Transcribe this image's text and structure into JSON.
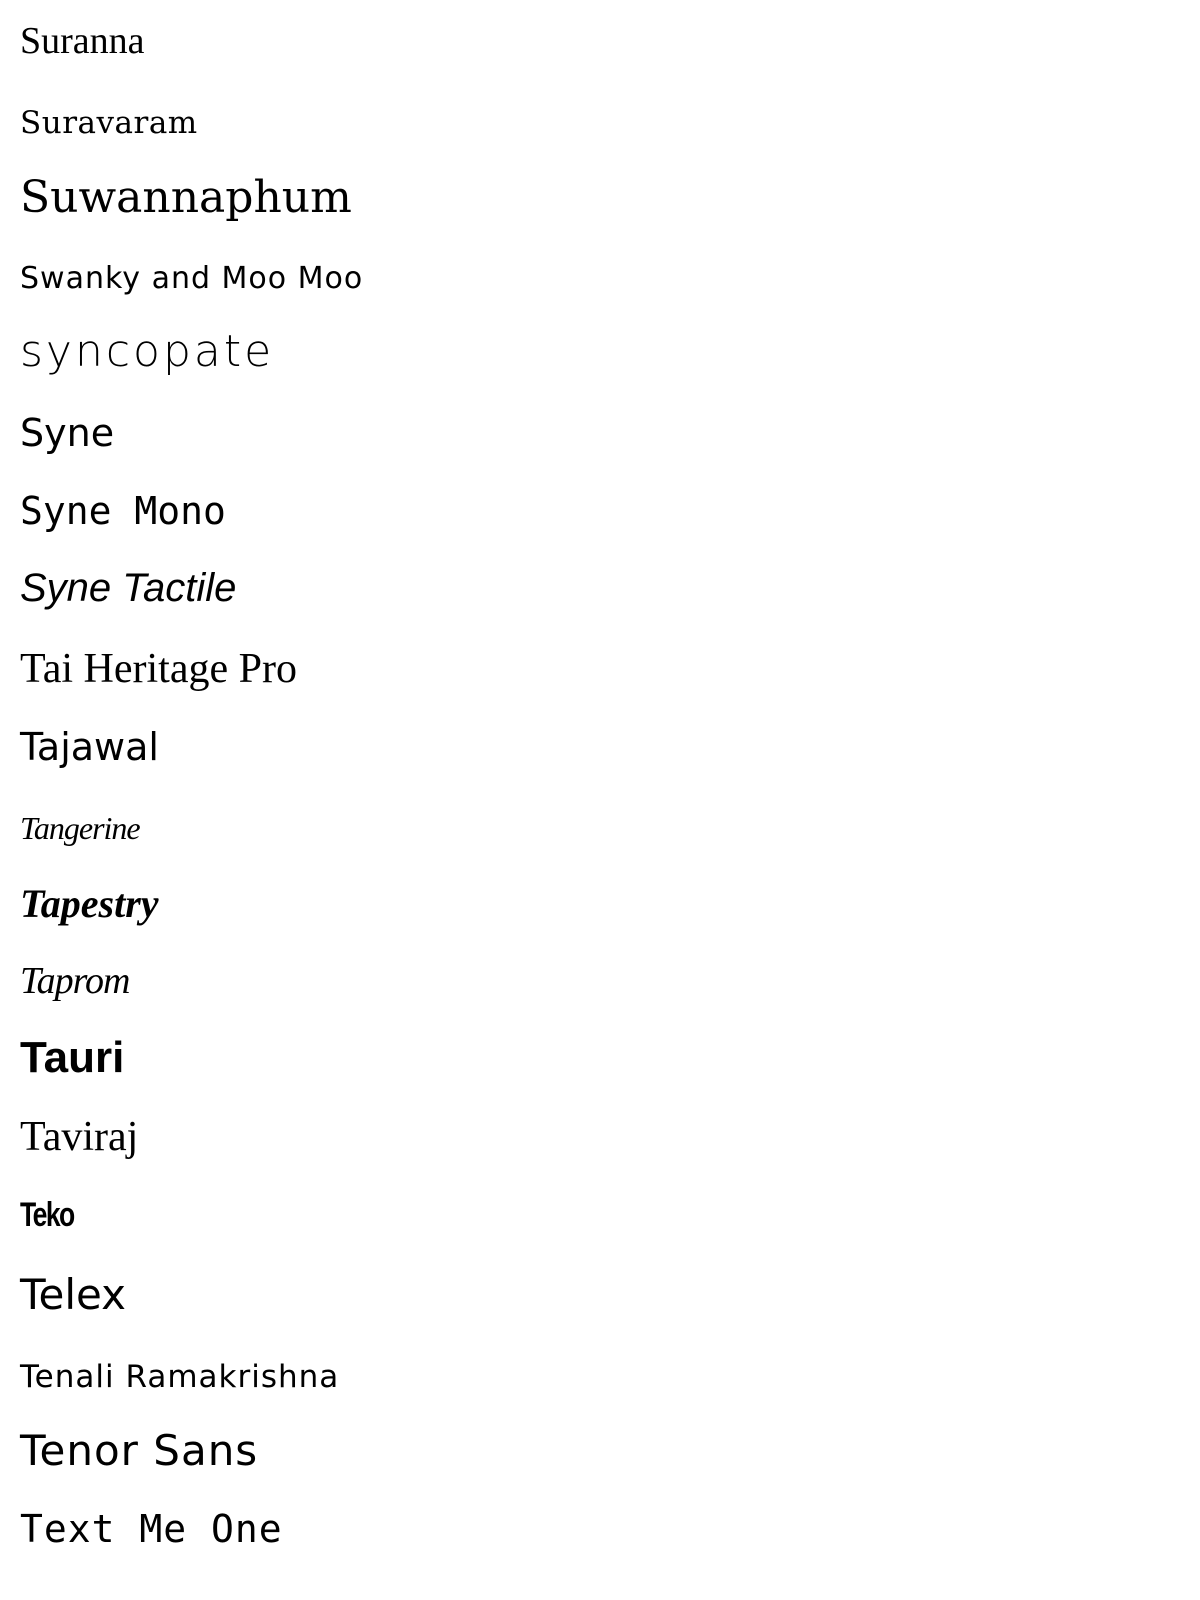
{
  "fonts": [
    {
      "label": "Suranna"
    },
    {
      "label": "Suravaram"
    },
    {
      "label": "Suwannaphum"
    },
    {
      "label": "Swanky and Moo Moo"
    },
    {
      "label": "syncopate"
    },
    {
      "label": "Syne"
    },
    {
      "label": "Syne Mono"
    },
    {
      "label": "Syne Tactile"
    },
    {
      "label": "Tai Heritage Pro"
    },
    {
      "label": "Tajawal"
    },
    {
      "label": "Tangerine"
    },
    {
      "label": "Tapestry"
    },
    {
      "label": "Taprom"
    },
    {
      "label": "Tauri"
    },
    {
      "label": "Taviraj"
    },
    {
      "label": "Teko"
    },
    {
      "label": "Telex"
    },
    {
      "label": "Tenali Ramakrishna"
    },
    {
      "label": "Tenor Sans"
    },
    {
      "label": "Text Me One"
    }
  ]
}
